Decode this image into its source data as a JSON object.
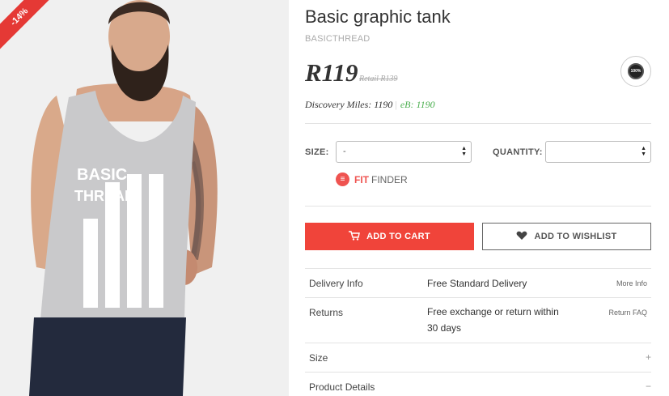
{
  "image": {
    "discount_badge": "-14%"
  },
  "product": {
    "title": "Basic graphic tank",
    "brand": "BASICTHREAD",
    "price": "R119",
    "retail_price": "Retail R139",
    "badge_text": "100%",
    "discovery_miles": "Discovery Miles: 1190",
    "ebucks": "eB: 1190"
  },
  "options": {
    "size_label": "SIZE:",
    "size_value": "-",
    "quantity_label": "QUANTITY:",
    "quantity_value": ""
  },
  "fit_finder": {
    "strong": "FIT",
    "rest": "FINDER"
  },
  "actions": {
    "add_to_cart": "ADD TO CART",
    "add_to_wishlist": "ADD TO WISHLIST"
  },
  "info_rows": [
    {
      "label": "Delivery Info",
      "value": "Free Standard Delivery",
      "link": "More Info"
    },
    {
      "label": "Returns",
      "value_line1": "Free exchange or return within",
      "value_line2": "30 days",
      "link": "Return FAQ"
    },
    {
      "label": "Size",
      "toggle": "+"
    },
    {
      "label": "Product Details",
      "toggle": "−"
    }
  ],
  "colors": {
    "accent_red": "#f0443a",
    "ebucks_green": "#4caf50",
    "shirt_grey": "#c9c9cb",
    "pants_navy": "#232a3d"
  },
  "icons": [
    "cart-icon",
    "heart-icon",
    "fit-finder-icon",
    "select-arrows-icon",
    "quality-seal-icon"
  ]
}
